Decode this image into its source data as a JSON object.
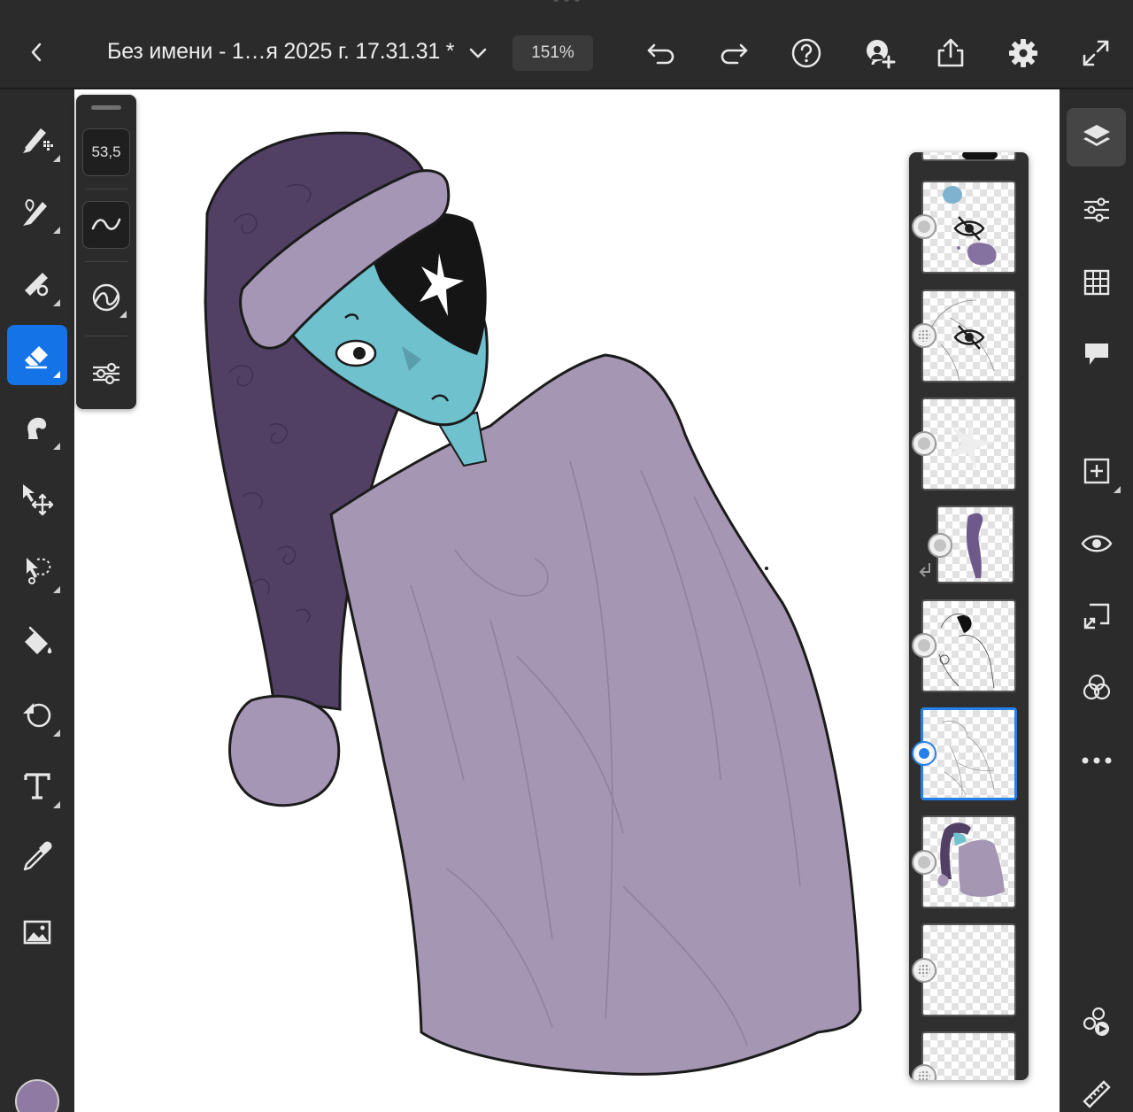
{
  "topbar": {
    "document_title": "Без имени - 1…я 2025 г. 17.31.31 *",
    "zoom_level": "151%",
    "icons": [
      "back-icon",
      "chevron-down-icon",
      "undo-icon",
      "redo-icon",
      "help-icon",
      "invite-icon",
      "share-icon",
      "settings-icon",
      "fullscreen-icon"
    ]
  },
  "left_toolbar": {
    "tools": [
      "pixel-brush",
      "live-brush",
      "vector-brush",
      "eraser",
      "smudge",
      "transform",
      "selection",
      "fill",
      "shape",
      "text",
      "eyedropper",
      "place-image"
    ],
    "active_tool": "eraser",
    "current_color": "#8e7aa3"
  },
  "brush_panel": {
    "size_value": "53,5"
  },
  "layers_panel": {
    "selected_index": 6,
    "hidden_layers": [
      1,
      2
    ]
  },
  "right_toolbar": {
    "tools": [
      "layers",
      "layer-properties",
      "grid",
      "comments",
      "add-layer",
      "visibility",
      "import",
      "blend",
      "more",
      "timelapse",
      "ruler"
    ],
    "active_tool": "layers"
  },
  "colors": {
    "accent": "#1473e6",
    "hat": "#514064",
    "hat_trim": "#a596b5",
    "coat": "#a597b3",
    "skin": "#6ec1cd"
  }
}
